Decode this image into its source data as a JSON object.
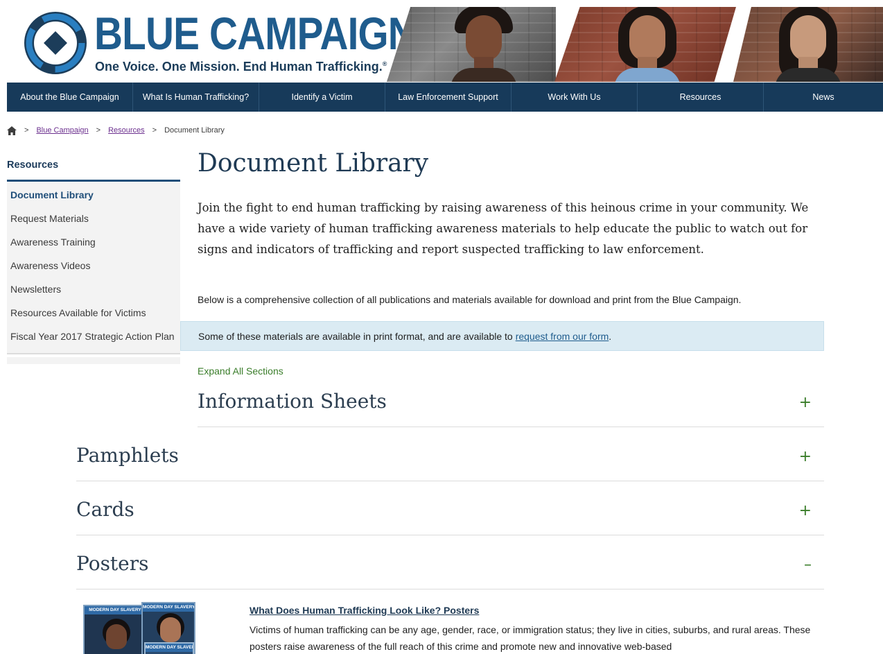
{
  "banner": {
    "logo_title": "BLUE CAMPAIGN",
    "tagline": "One Voice. One Mission. End Human Trafficking.",
    "registered_mark": "®"
  },
  "nav": {
    "items": [
      "About the Blue Campaign",
      "What Is Human Trafficking?",
      "Identify a Victim",
      "Law Enforcement Support",
      "Work With Us",
      "Resources",
      "News"
    ]
  },
  "breadcrumb": {
    "separator": ">",
    "items": [
      "Blue Campaign",
      "Resources"
    ],
    "current": "Document Library"
  },
  "sidebar": {
    "heading": "Resources",
    "items": [
      "Document Library",
      "Request Materials",
      "Awareness Training",
      "Awareness Videos",
      "Newsletters",
      "Resources Available for Victims",
      "Fiscal Year 2017 Strategic Action Plan"
    ]
  },
  "main": {
    "title": "Document Library",
    "intro": "Join the fight to end human trafficking by raising awareness of this heinous crime in your community. We have a wide variety of human trafficking awareness materials to help educate the public to watch out for signs and indicators of trafficking and report suspected trafficking to law enforcement.",
    "below": "Below is a comprehensive collection of all publications and materials available for download and print from the Blue Campaign.",
    "notice_text": "Some of these materials are available in print format, and are available to",
    "notice_link": "request from our form",
    "notice_end": ".",
    "expand_all": "Expand All Sections",
    "sections": [
      {
        "title": "Information Sheets",
        "toggle": "+"
      },
      {
        "title": "Pamphlets",
        "toggle": "+"
      },
      {
        "title": "Cards",
        "toggle": "+"
      },
      {
        "title": "Posters",
        "toggle": "–"
      }
    ],
    "poster": {
      "link": "What Does Human Trafficking Look Like? Posters",
      "description": "Victims of human trafficking can be any age, gender, race, or immigration status; they live in cities, suburbs, and rural areas. These posters raise awareness of the full reach of this crime and promote new and innovative web-based",
      "thumb_band": "MODERN DAY SLAVERY"
    }
  },
  "colors": {
    "navbar": "#173a5a",
    "brand_blue": "#1f5c8d",
    "toggle_green": "#3a7d2a",
    "notice_bg": "#dbebf3"
  },
  "icons": {
    "home": "home-icon",
    "logo": "circle-arrows-logo-icon"
  }
}
